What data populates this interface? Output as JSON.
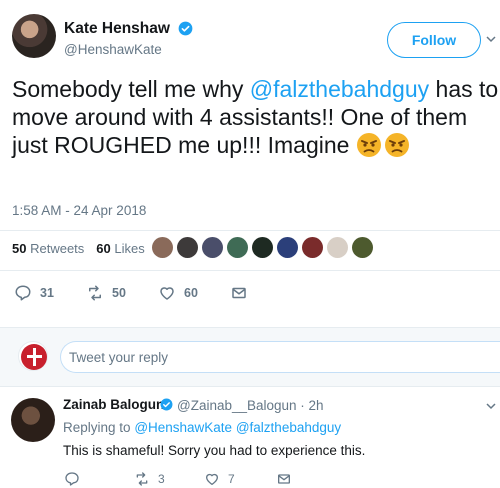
{
  "tweet": {
    "author_name": "Kate Henshaw",
    "author_handle": "@HenshawKate",
    "follow_label": "Follow",
    "text_part1": "Somebody tell me why ",
    "mention": "@falzthebahdguy",
    "text_part2": " has to move around with 4 assistants!! One of them just ROUGHED me up!!! Imagine",
    "emoji": [
      "angry-face",
      "angry-face"
    ],
    "timestamp": "1:58 AM - 24 Apr 2018",
    "retweets_count": "50",
    "retweets_label": "Retweets",
    "likes_count": "60",
    "likes_label": "Likes",
    "actions": {
      "reply_count": "31",
      "retweet_count": "50",
      "like_count": "60"
    }
  },
  "reply_box": {
    "placeholder": "Tweet your reply"
  },
  "reply": {
    "author_name": "Zainab Balogun",
    "author_handle": "@Zainab__Balogun · 2h",
    "replying_prefix": "Replying to",
    "replying_mention1": "@HenshawKate",
    "replying_mention2": "@falzthebahdguy",
    "text": "This is shameful! Sorry you had to experience this.",
    "actions": {
      "reply_count": "",
      "retweet_count": "3",
      "like_count": "7"
    }
  },
  "colors": {
    "accent": "#1da1f2",
    "muted": "#657786",
    "text": "#14171a"
  },
  "icons": [
    "verified-badge-icon",
    "chevron-down-icon",
    "reply-icon",
    "retweet-icon",
    "like-icon",
    "message-icon"
  ]
}
